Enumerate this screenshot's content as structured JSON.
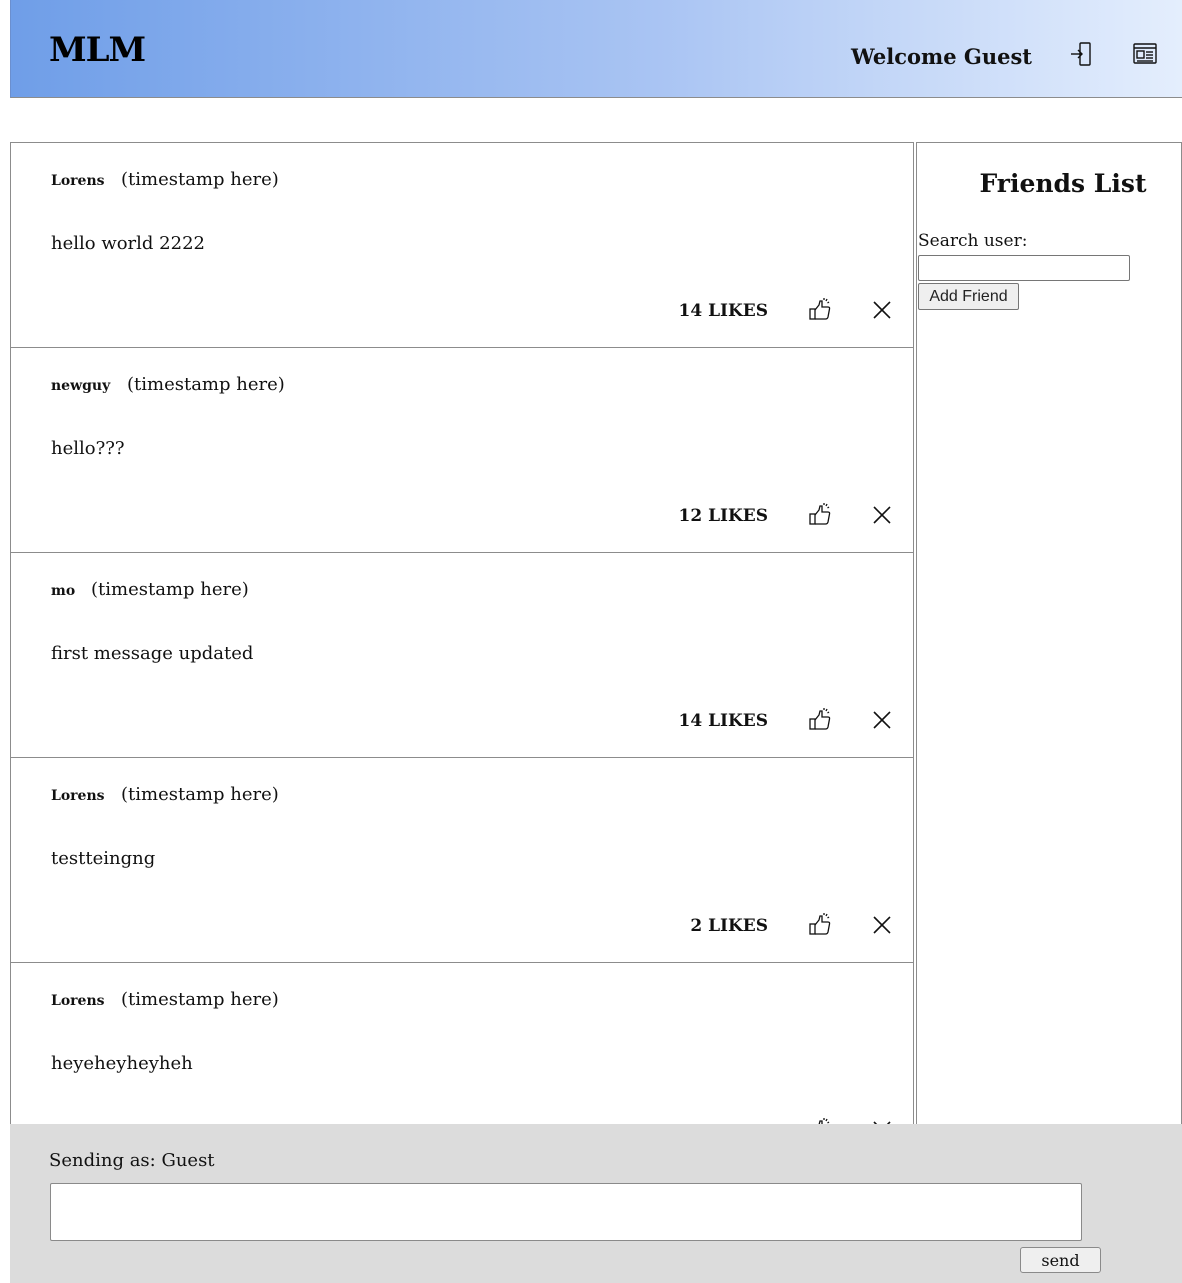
{
  "header": {
    "logo": "MLM",
    "welcome": "Welcome Guest",
    "icons": [
      "login-icon",
      "profile-card-icon"
    ]
  },
  "posts": [
    {
      "user": "Lorens",
      "time": "(timestamp here)",
      "message": "hello world 2222",
      "likes": "14 LIKES"
    },
    {
      "user": "newguy",
      "time": "(timestamp here)",
      "message": "hello???",
      "likes": "12 LIKES"
    },
    {
      "user": "mo",
      "time": "(timestamp here)",
      "message": "first message updated",
      "likes": "14 LIKES"
    },
    {
      "user": "Lorens",
      "time": "(timestamp here)",
      "message": "testteingng",
      "likes": "2 LIKES"
    },
    {
      "user": "Lorens",
      "time": "(timestamp here)",
      "message": "heyeheyheyheh",
      "likes": ""
    }
  ],
  "friends": {
    "title": "Friends List",
    "search_label": "Search user:",
    "search_value": "",
    "add_button": "Add Friend"
  },
  "composer": {
    "sending_as": "Sending as: Guest",
    "message_value": "",
    "send_button": "send"
  },
  "colors": {
    "header_gradient_start": "#6f9ee8",
    "header_gradient_end": "#e4eefd",
    "composer_bg": "#dcdcdc"
  }
}
